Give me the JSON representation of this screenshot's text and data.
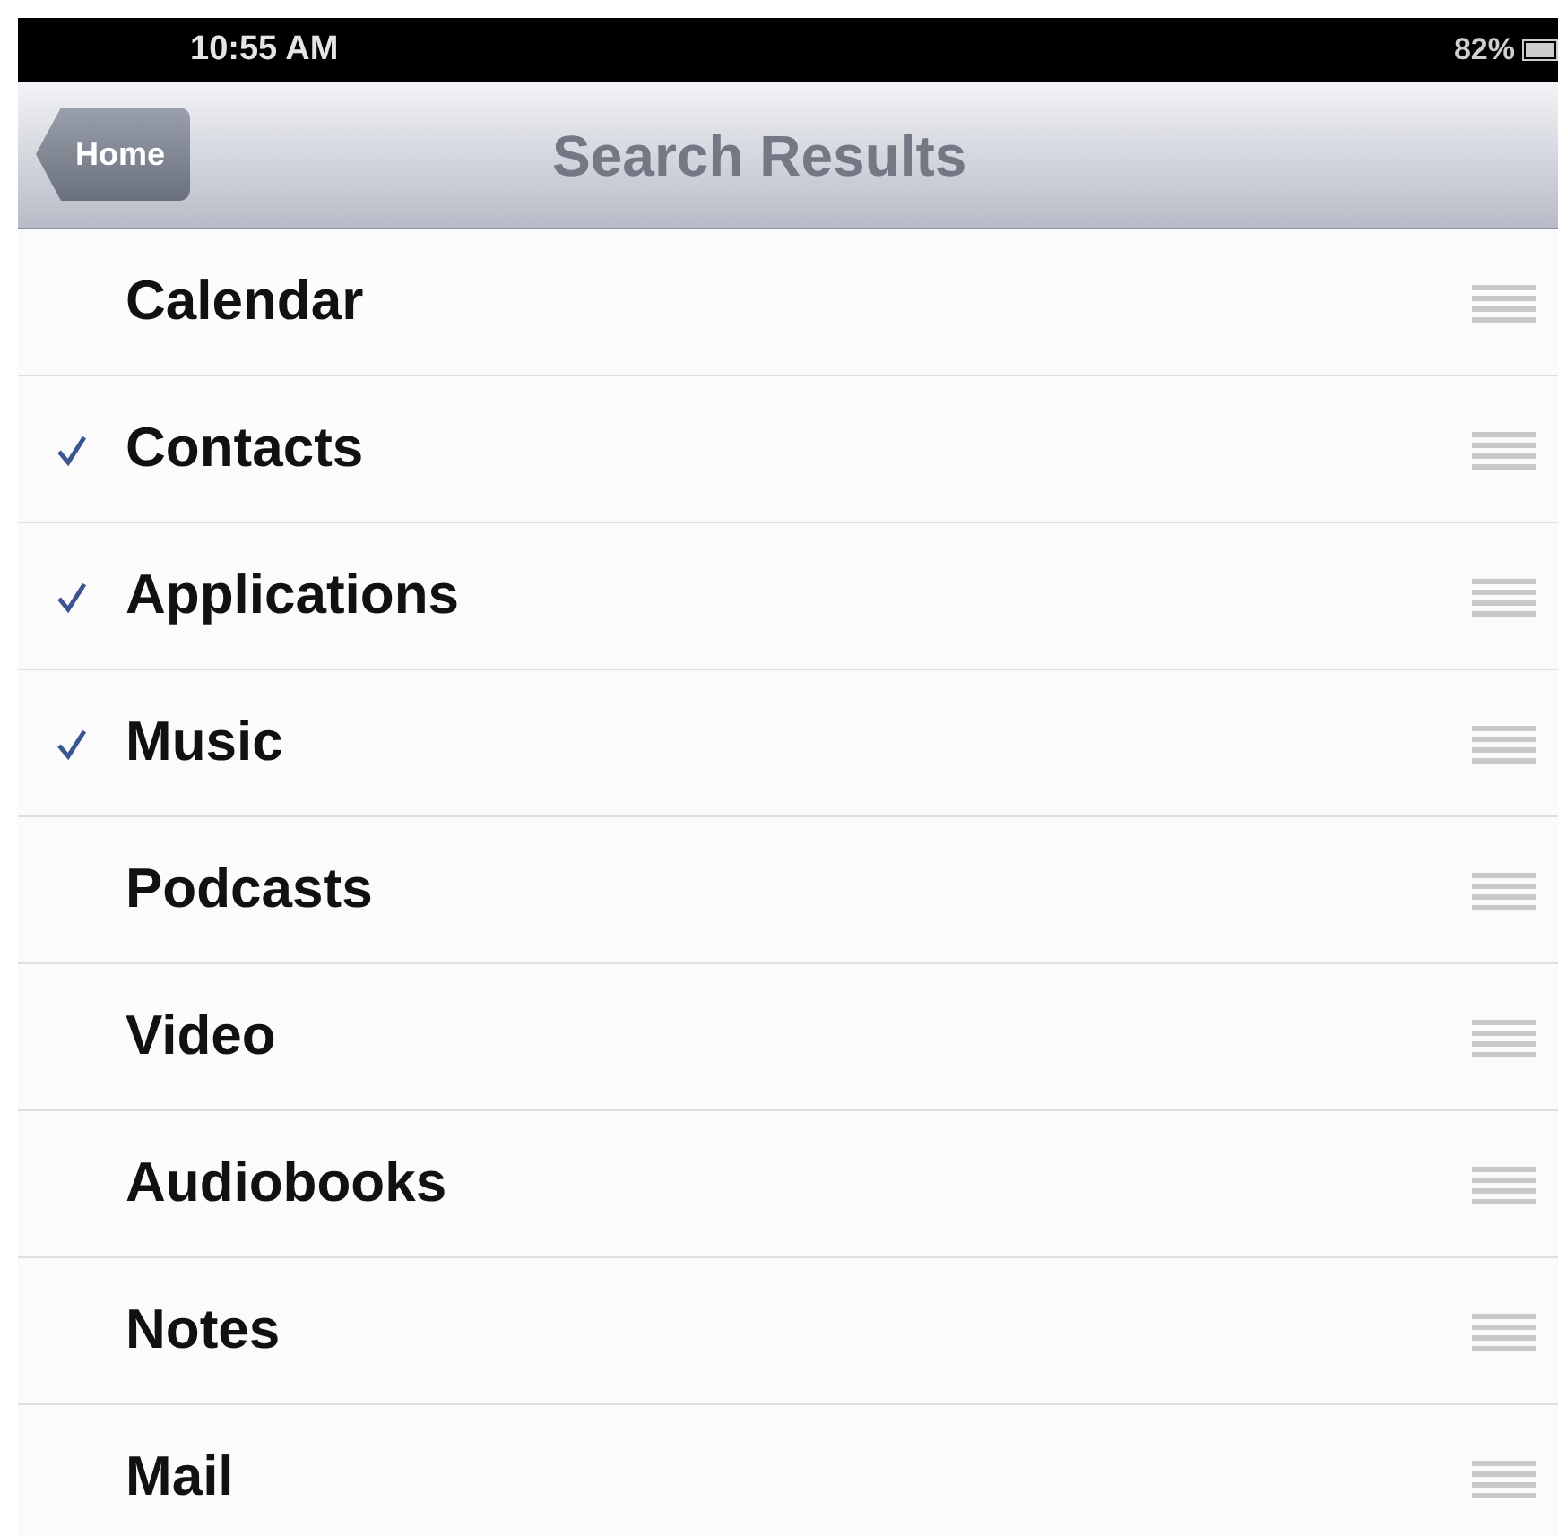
{
  "status_bar": {
    "time": "10:55 AM",
    "battery": "82%"
  },
  "nav_bar": {
    "back_button": "Home",
    "title": "Search Results"
  },
  "items": [
    {
      "label": "Calendar",
      "checked": false
    },
    {
      "label": "Contacts",
      "checked": true
    },
    {
      "label": "Applications",
      "checked": true
    },
    {
      "label": "Music",
      "checked": true
    },
    {
      "label": "Podcasts",
      "checked": false
    },
    {
      "label": "Video",
      "checked": false
    },
    {
      "label": "Audiobooks",
      "checked": false
    },
    {
      "label": "Notes",
      "checked": false
    },
    {
      "label": "Mail",
      "checked": false
    }
  ]
}
